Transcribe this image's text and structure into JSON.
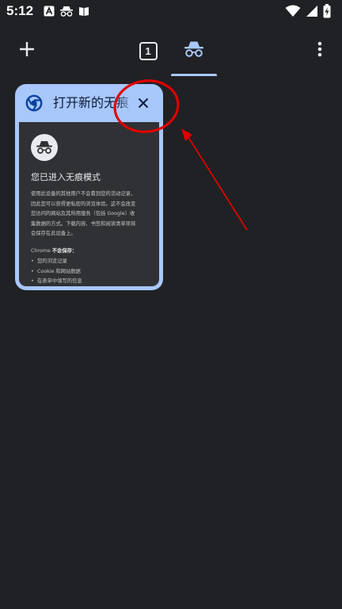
{
  "status_bar": {
    "time": "5:12",
    "left_icons": [
      "text-a-icon",
      "incognito-small-icon",
      "book-icon"
    ],
    "right_icons": [
      "wifi-icon",
      "signal-icon",
      "battery-charging-icon"
    ]
  },
  "toolbar": {
    "new_tab_icon": "plus-icon",
    "tab_count": "1",
    "incognito_icon": "incognito-icon",
    "menu_icon": "more-vert-icon",
    "accent_color": "#a8c7fa"
  },
  "tab_card": {
    "favicon": "chrome-icon",
    "title": "打开新的无痕式标签页",
    "close_icon": "close-icon",
    "thumbnail": {
      "heading": "您已进入无痕模式",
      "paragraphs": [
        "使用此设备的其他用户不会看到您的活动记录，",
        "因此您可以获得更私密的浏览体验。这不会改变",
        "您访问的网站及其所用服务（包括 Google）收",
        "集数据的方式。下载内容、书签和阅读清单项将",
        "会保存在此设备上。"
      ],
      "list_title_prefix": "Chrome",
      "list_title_bold": "不会保存：",
      "list_items": [
        "您的浏览记录",
        "Cookie 和网站数据",
        "在表单中填写的信息"
      ],
      "bullet": "•"
    }
  },
  "annotation": {
    "circle_color": "#e00000",
    "arrow_color": "#e00000"
  }
}
